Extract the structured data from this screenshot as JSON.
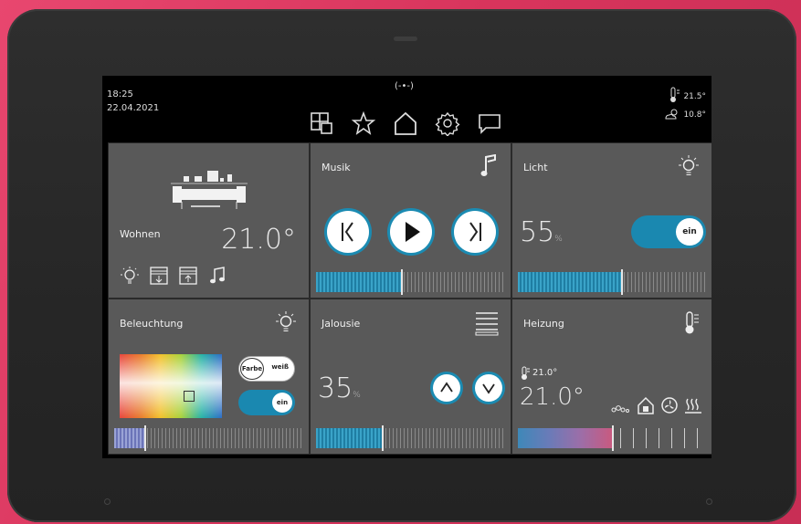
{
  "topbar": {
    "time": "18:25",
    "date": "22.04.2021",
    "connection": "(-•-)",
    "temp_indoor": "21.5°",
    "temp_outdoor": "10.8°",
    "nav_icons": [
      "rooms-icon",
      "favorites-icon",
      "home-icon",
      "settings-icon",
      "messages-icon"
    ]
  },
  "tiles": {
    "wohnen": {
      "title": "Wohnen",
      "temperature": "21.0°"
    },
    "musik": {
      "title": "Musik",
      "volume": 0.45
    },
    "licht": {
      "title": "Licht",
      "value": "55",
      "unit": "%",
      "toggle": "ein",
      "level": 0.55
    },
    "beleuchtung": {
      "title": "Beleuchtung",
      "option_color": "Farbe",
      "option_white": "weiß",
      "toggle": "ein",
      "level": 0.16
    },
    "jalousie": {
      "title": "Jalousie",
      "value": "35",
      "unit": "%",
      "level": 0.35
    },
    "heizung": {
      "title": "Heizung",
      "setpoint": "21.0°",
      "temperature": "21.0°",
      "level": 0.5
    }
  },
  "colors": {
    "accent": "#1b8bb2",
    "tile": "#595959",
    "background": "#000000"
  }
}
